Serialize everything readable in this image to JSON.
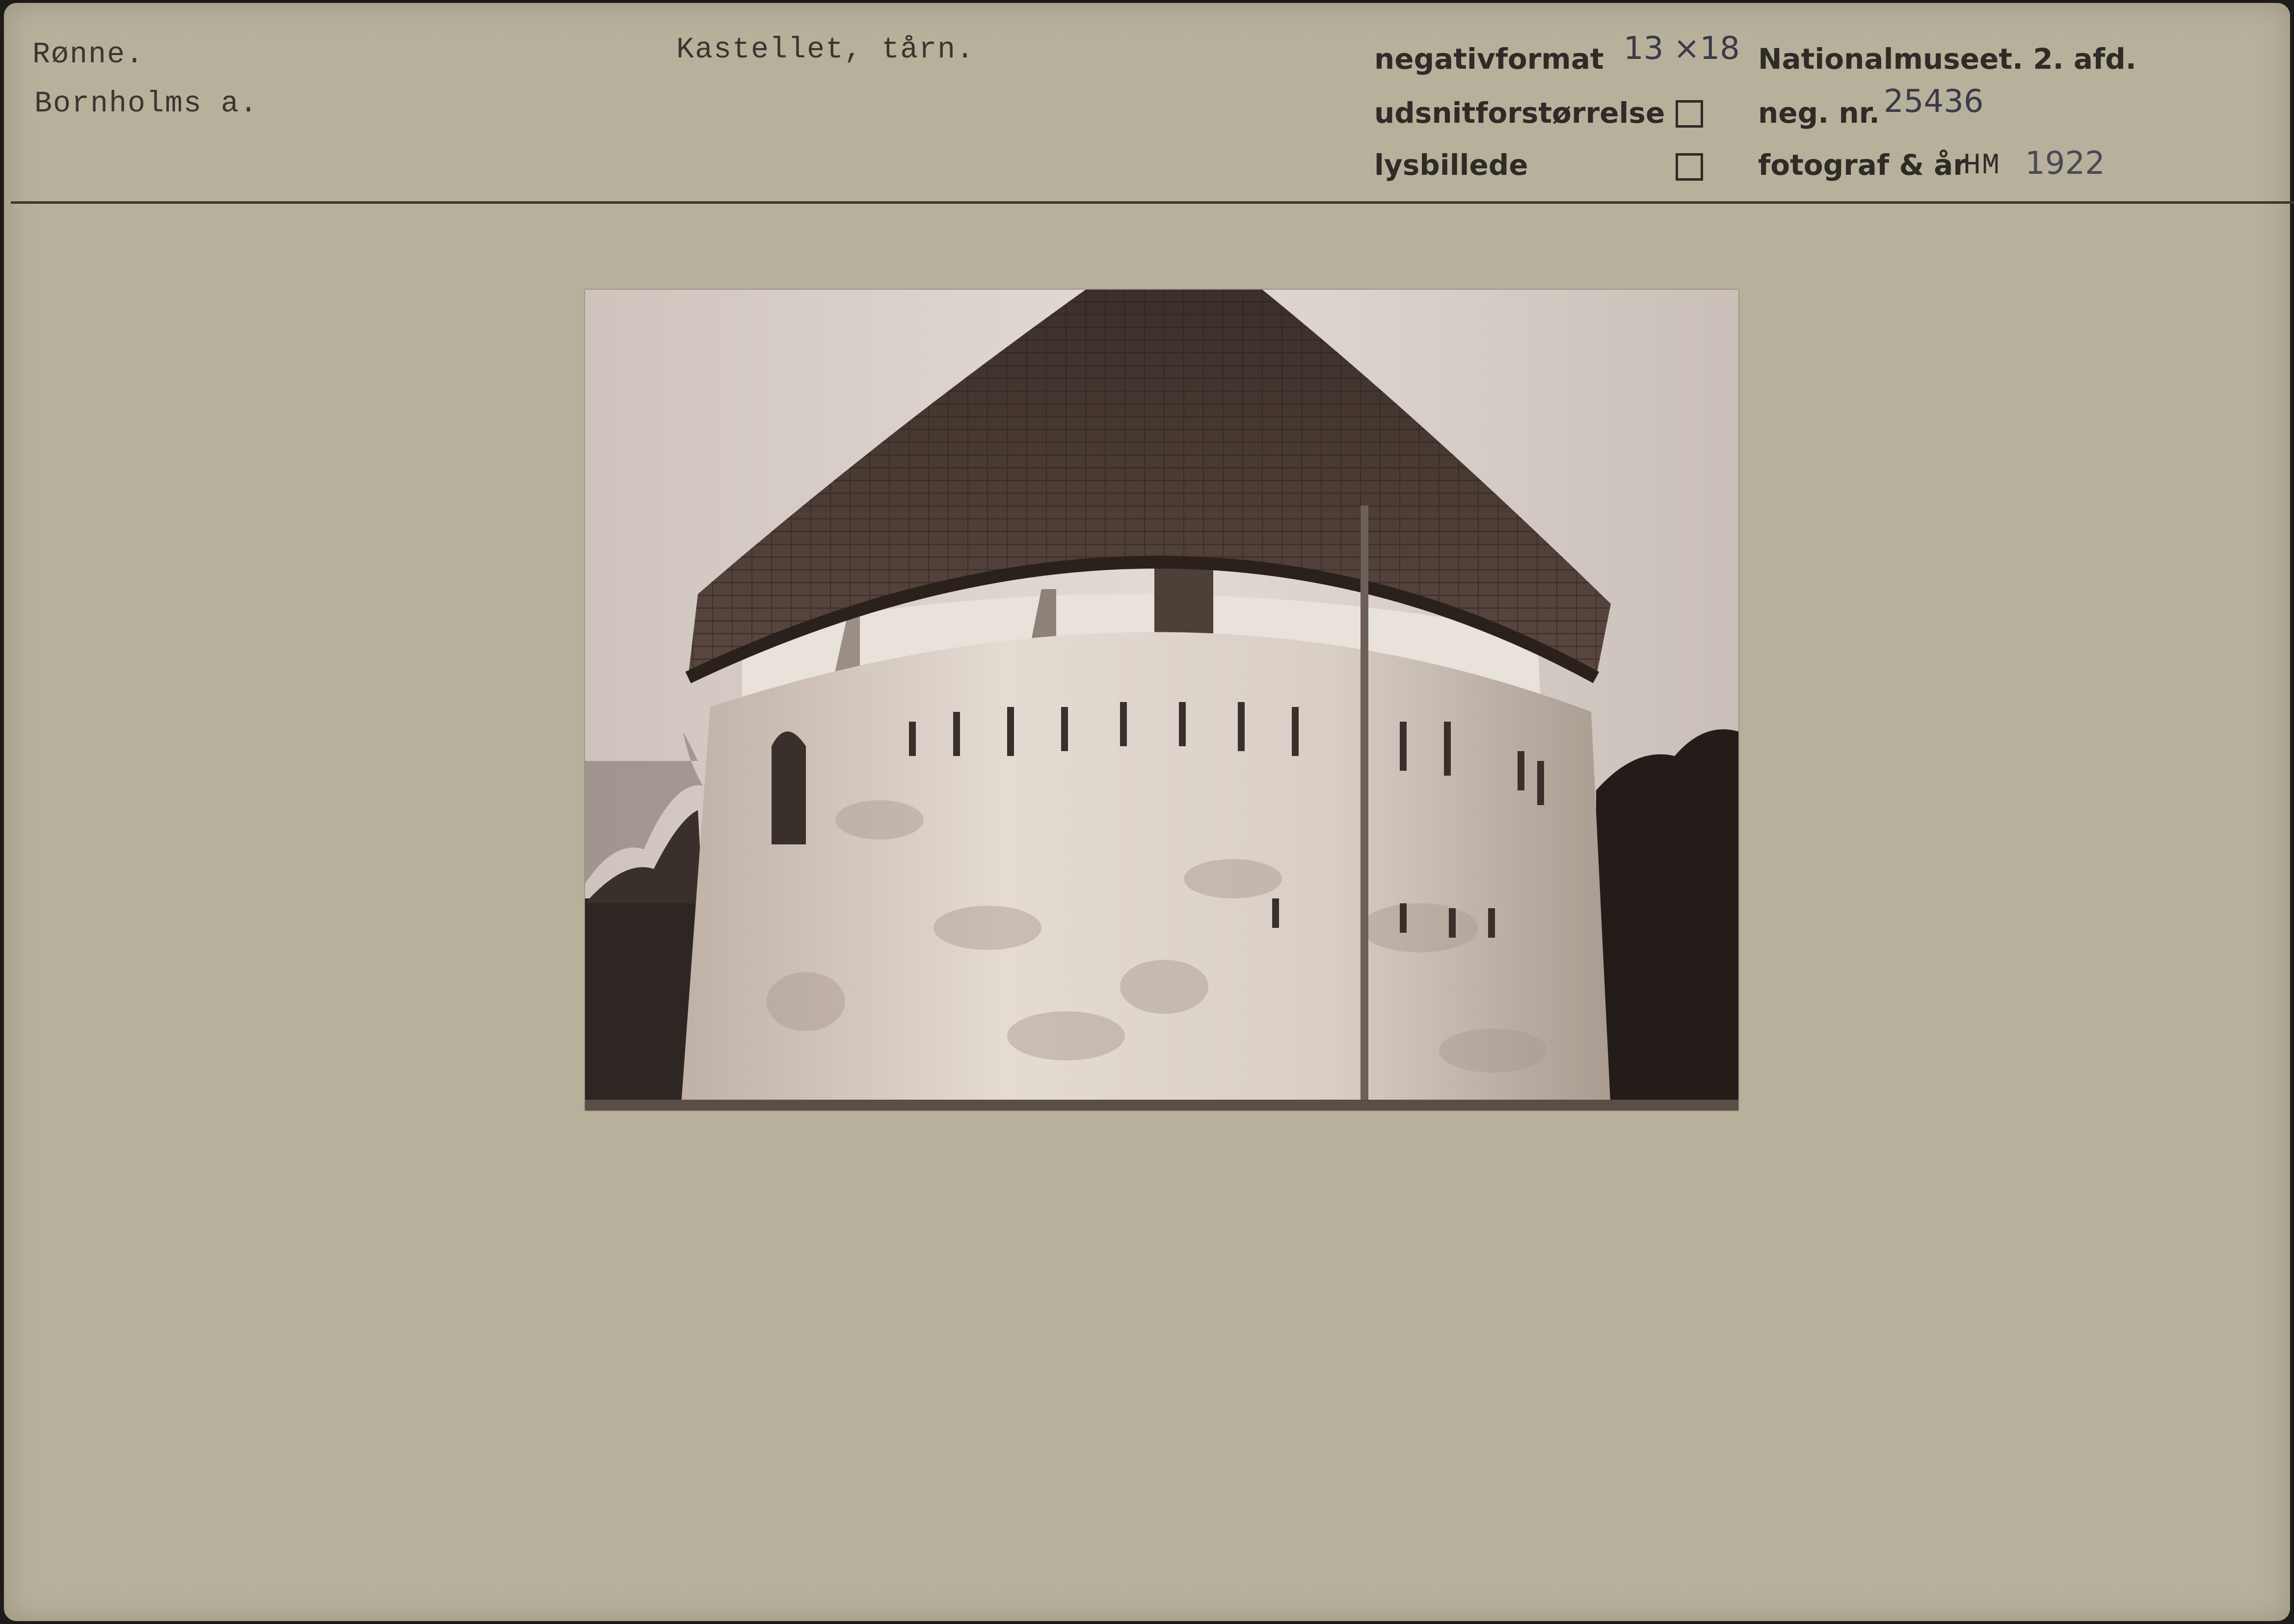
{
  "card": {
    "place": "Rønne.",
    "county": "Bornholms a.",
    "subject": "Kastellet, tårn.",
    "labels": {
      "negativformat": "negativformat",
      "udsnit": "udsnitforstørrelse",
      "lysbillede": "lysbillede",
      "museum": "Nationalmuseet. 2. afd.",
      "negnr": "neg. nr.",
      "fotograf": "fotograf & år"
    },
    "values": {
      "format": "13 ×18",
      "negnr": "25436",
      "photographer": "HM",
      "year": "1922"
    }
  },
  "photo": {
    "tone": "#dcd4cc"
  }
}
